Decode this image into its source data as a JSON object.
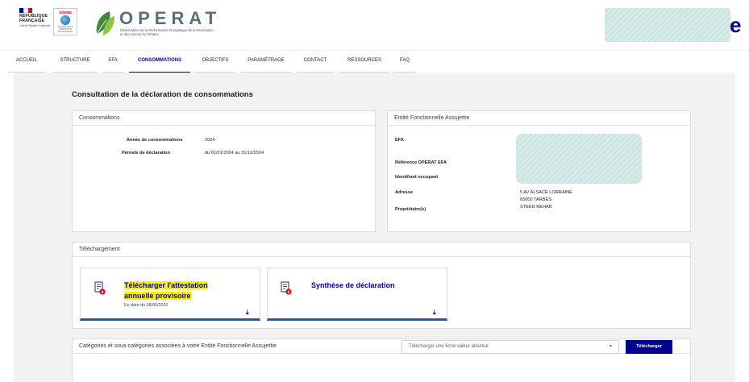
{
  "header": {
    "rf_lines": [
      "RÉPUBLIQUE",
      "FRANÇAISE"
    ],
    "rf_motto": "Liberté Égalité Fraternité",
    "ademe_label": "ADEME",
    "ademe_sub": "AGENCE DE LA TRANSITION ÉCOLOGIQUE",
    "operat_title": "OPERAT",
    "operat_sub": "Observatoire de la Performance Énergétique de la Rénovation et des Actions du Tertiaire",
    "user_initial": "e",
    "flag_colors": [
      "#000091",
      "#ffffff",
      "#e1000f"
    ]
  },
  "nav": {
    "items": [
      {
        "label": "ACCUEIL",
        "active": false
      },
      {
        "label": "STRUCTURE",
        "active": false
      },
      {
        "label": "EFA",
        "active": false
      },
      {
        "label": "CONSOMMATIONS",
        "active": true
      },
      {
        "label": "OBJECTIFS",
        "active": false
      },
      {
        "label": "PARAMÉTRAGE",
        "active": false
      },
      {
        "label": "CONTACT",
        "active": false
      },
      {
        "label": "RESSOURCES",
        "active": false
      },
      {
        "label": "FAQ",
        "active": false
      }
    ]
  },
  "page": {
    "title": "Consultation de la déclaration de consommations"
  },
  "consommations": {
    "header": "Consommations",
    "annee_label": "Année de consommations",
    "annee_value": "2024",
    "periode_label": "Période de déclaration",
    "periode_value": "du 01/01/2024 au 31/12/2024"
  },
  "efa": {
    "header": "Entité Fonctionnelle Assujettie",
    "efa_label": "EFA",
    "ref_label": "Référence OPERAT EFA",
    "occupant_label": "Identifiant occupant",
    "adresse_label": "Adresse",
    "adresse_line1": "5 AV ALSACE LORRAINE",
    "adresse_line2": "65000 TARBES",
    "proprietaire_label": "Propriétaire(s)",
    "proprietaire_value": "STEEN REHAB"
  },
  "telechargement": {
    "header": "Téléchargement",
    "attestation_line1": "Télécharger l'attestation",
    "attestation_line2": "annuelle provisoire",
    "attestation_date": "En date du 08/09/2025",
    "synthese_title": "Synthèse de déclaration"
  },
  "categories": {
    "header": "Catégories et sous-catégories associées à votre Entité Fonctionnelle Assujettie",
    "select_placeholder": "Télécharger une fiche valeur absolue",
    "button_label": "Télécharger"
  },
  "colors": {
    "accent": "#000091",
    "highlight": "#fff200",
    "mask": "#cce5e2",
    "download_border": "#1f5aa8"
  }
}
